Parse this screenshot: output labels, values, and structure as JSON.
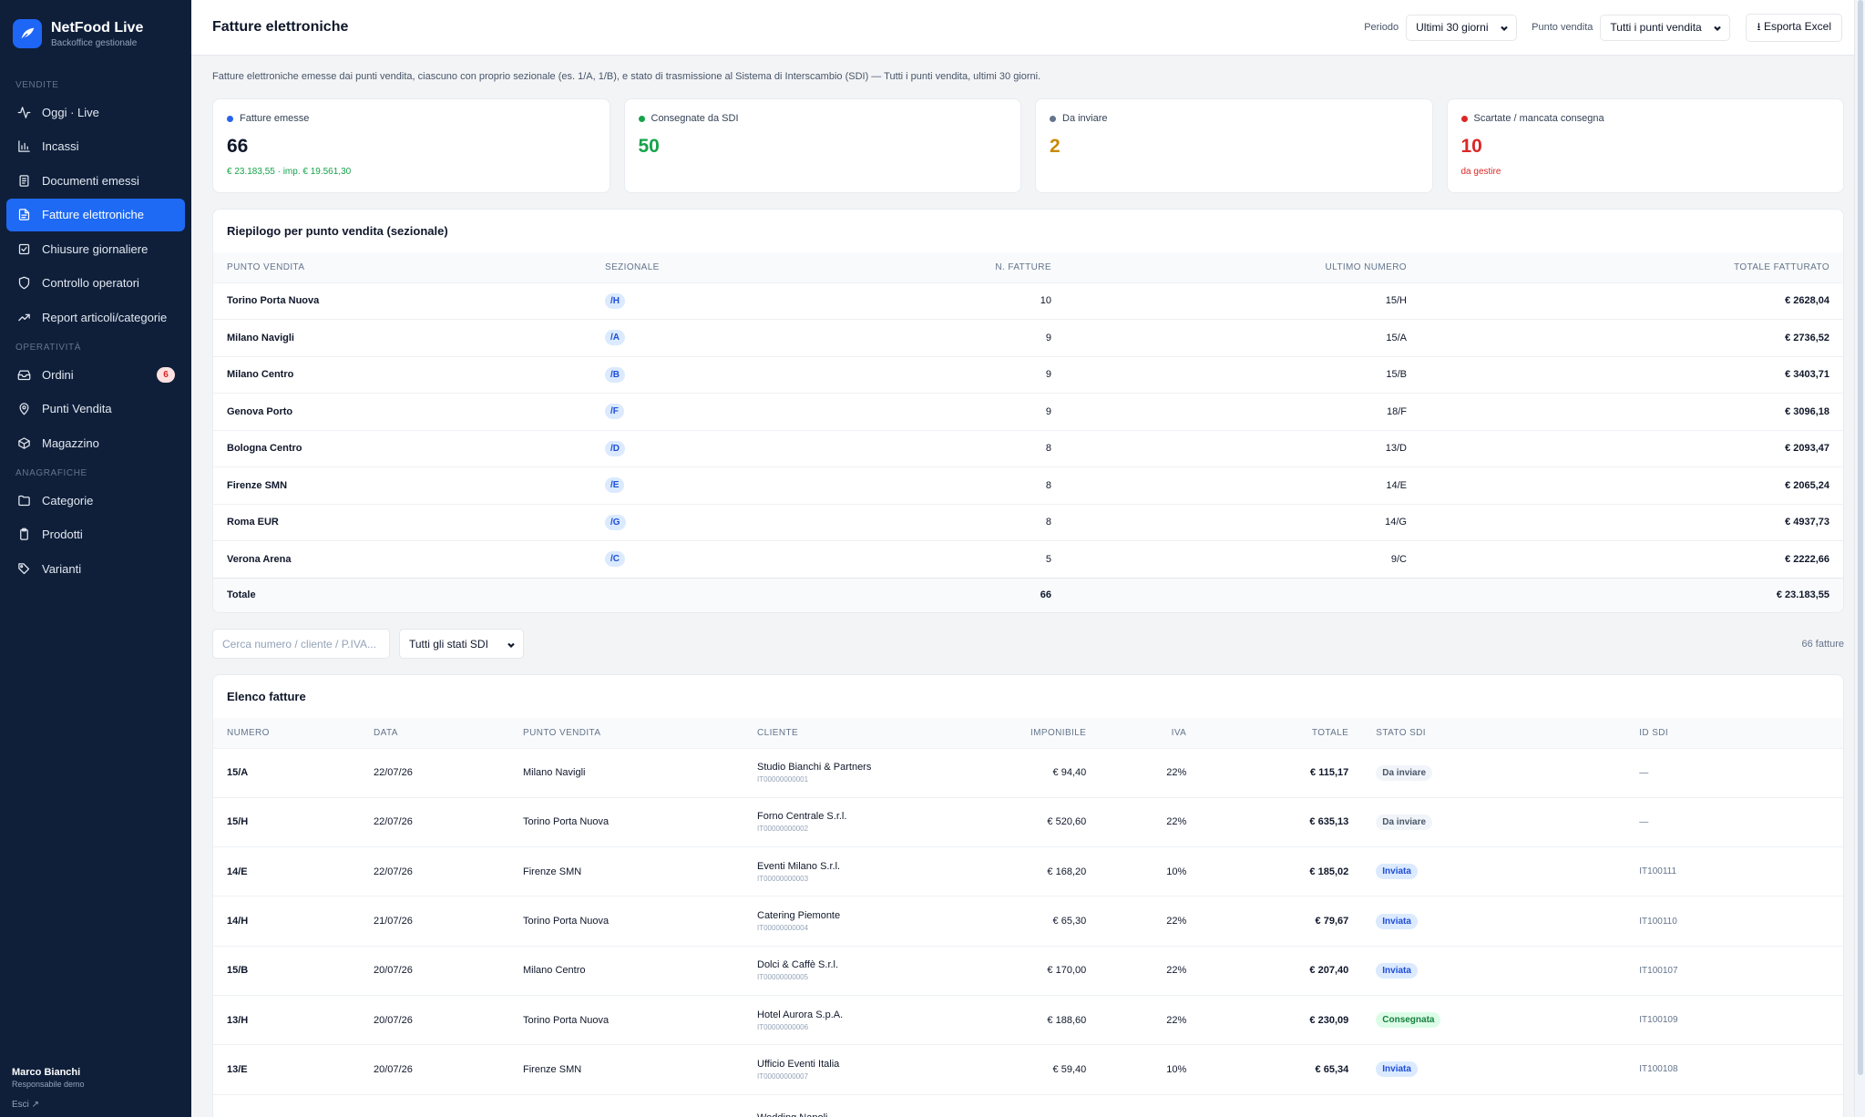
{
  "brand": {
    "name": "NetFood Live",
    "subtitle": "Backoffice gestionale"
  },
  "sidebar": {
    "sections": [
      {
        "title": "Vendite",
        "items": [
          {
            "label": "Oggi · Live",
            "icon": "activity-icon"
          },
          {
            "label": "Incassi",
            "icon": "bar-chart-icon"
          },
          {
            "label": "Documenti emessi",
            "icon": "receipt-icon"
          },
          {
            "label": "Fatture elettroniche",
            "icon": "file-icon",
            "active": true
          },
          {
            "label": "Chiusure giornaliere",
            "icon": "check-square-icon"
          },
          {
            "label": "Controllo operatori",
            "icon": "shield-icon"
          },
          {
            "label": "Report articoli/categorie",
            "icon": "trending-up-icon"
          }
        ]
      },
      {
        "title": "Operatività",
        "items": [
          {
            "label": "Ordini",
            "icon": "inbox-icon",
            "badge": "6"
          },
          {
            "label": "Punti Vendita",
            "icon": "map-pin-icon"
          },
          {
            "label": "Magazzino",
            "icon": "box-icon"
          }
        ]
      },
      {
        "title": "Anagrafiche",
        "items": [
          {
            "label": "Categorie",
            "icon": "folder-icon"
          },
          {
            "label": "Prodotti",
            "icon": "clipboard-icon"
          },
          {
            "label": "Varianti",
            "icon": "tag-icon"
          }
        ]
      }
    ]
  },
  "user": {
    "name": "Marco Bianchi",
    "role": "Responsabile demo",
    "logout": "Esci ↗"
  },
  "header": {
    "title": "Fatture elettroniche",
    "period_label": "Periodo",
    "period_value": "Ultimi 30 giorni",
    "store_label": "Punto vendita",
    "store_value": "Tutti i punti vendita",
    "export_label": "⭳ Esporta Excel"
  },
  "intro": "Fatture elettroniche emesse dai punti vendita, ciascuno con proprio sezionale (es. 1/A, 1/B), e stato di trasmissione al Sistema di Interscambio (SDI) — Tutti i punti vendita, ultimi 30 giorni.",
  "kpis": [
    {
      "label": "Fatture emesse",
      "value": "66",
      "sub": "€ 23.183,55 · imp. € 19.561,30",
      "dot": "#2563eb",
      "value_color": "#0f172a",
      "sub_color": "#16a34a"
    },
    {
      "label": "Consegnate da SDI",
      "value": "50",
      "sub": "",
      "dot": "#16a34a",
      "value_color": "#16a34a",
      "sub_color": "#16a34a"
    },
    {
      "label": "Da inviare",
      "value": "2",
      "sub": "",
      "dot": "#64748b",
      "value_color": "#ca8a04",
      "sub_color": "#64748b"
    },
    {
      "label": "Scartate / mancata consegna",
      "value": "10",
      "sub": "da gestire",
      "dot": "#dc2626",
      "value_color": "#dc2626",
      "sub_color": "#dc2626"
    }
  ],
  "summary": {
    "title": "Riepilogo per punto vendita (sezionale)",
    "columns": [
      "Punto vendita",
      "Sezionale",
      "N. fatture",
      "Ultimo numero",
      "Totale fatturato"
    ],
    "rows": [
      {
        "store": "Torino Porta Nuova",
        "sezionale": "/H",
        "count": "10",
        "last": "15/H",
        "total": "€ 2628,04"
      },
      {
        "store": "Milano Navigli",
        "sezionale": "/A",
        "count": "9",
        "last": "15/A",
        "total": "€ 2736,52"
      },
      {
        "store": "Milano Centro",
        "sezionale": "/B",
        "count": "9",
        "last": "15/B",
        "total": "€ 3403,71"
      },
      {
        "store": "Genova Porto",
        "sezionale": "/F",
        "count": "9",
        "last": "18/F",
        "total": "€ 3096,18"
      },
      {
        "store": "Bologna Centro",
        "sezionale": "/D",
        "count": "8",
        "last": "13/D",
        "total": "€ 2093,47"
      },
      {
        "store": "Firenze SMN",
        "sezionale": "/E",
        "count": "8",
        "last": "14/E",
        "total": "€ 2065,24"
      },
      {
        "store": "Roma EUR",
        "sezionale": "/G",
        "count": "8",
        "last": "14/G",
        "total": "€ 4937,73"
      },
      {
        "store": "Verona Arena",
        "sezionale": "/C",
        "count": "5",
        "last": "9/C",
        "total": "€ 2222,66"
      }
    ],
    "total_label": "Totale",
    "total_count": "66",
    "total_amount": "€ 23.183,55"
  },
  "filters": {
    "search_placeholder": "Cerca numero / cliente / P.IVA...",
    "status_value": "Tutti gli stati SDI",
    "count": "66 fatture"
  },
  "invoices": {
    "title": "Elenco fatture",
    "columns": [
      "Numero",
      "Data",
      "Punto vendita",
      "Cliente",
      "Imponibile",
      "IVA",
      "Totale",
      "Stato SDI",
      "ID SDI"
    ],
    "rows": [
      {
        "num": "15/A",
        "date": "22/07/26",
        "store": "Milano Navigli",
        "client": "Studio Bianchi & Partners",
        "vat": "IT00000000001",
        "imp": "€ 94,40",
        "iva": "22%",
        "tot": "€ 115,17",
        "status": "Da inviare",
        "st": "da",
        "id": "—"
      },
      {
        "num": "15/H",
        "date": "22/07/26",
        "store": "Torino Porta Nuova",
        "client": "Forno Centrale S.r.l.",
        "vat": "IT00000000002",
        "imp": "€ 520,60",
        "iva": "22%",
        "tot": "€ 635,13",
        "status": "Da inviare",
        "st": "da",
        "id": "—"
      },
      {
        "num": "14/E",
        "date": "22/07/26",
        "store": "Firenze SMN",
        "client": "Eventi Milano S.r.l.",
        "vat": "IT00000000003",
        "imp": "€ 168,20",
        "iva": "10%",
        "tot": "€ 185,02",
        "status": "Inviata",
        "st": "inv",
        "id": "IT100111"
      },
      {
        "num": "14/H",
        "date": "21/07/26",
        "store": "Torino Porta Nuova",
        "client": "Catering Piemonte",
        "vat": "IT00000000004",
        "imp": "€ 65,30",
        "iva": "22%",
        "tot": "€ 79,67",
        "status": "Inviata",
        "st": "inv",
        "id": "IT100110"
      },
      {
        "num": "15/B",
        "date": "20/07/26",
        "store": "Milano Centro",
        "client": "Dolci & Caffè S.r.l.",
        "vat": "IT00000000005",
        "imp": "€ 170,00",
        "iva": "22%",
        "tot": "€ 207,40",
        "status": "Inviata",
        "st": "inv",
        "id": "IT100107"
      },
      {
        "num": "13/H",
        "date": "20/07/26",
        "store": "Torino Porta Nuova",
        "client": "Hotel Aurora S.p.A.",
        "vat": "IT00000000006",
        "imp": "€ 188,60",
        "iva": "22%",
        "tot": "€ 230,09",
        "status": "Consegnata",
        "st": "con",
        "id": "IT100109"
      },
      {
        "num": "13/E",
        "date": "20/07/26",
        "store": "Firenze SMN",
        "client": "Ufficio Eventi Italia",
        "vat": "IT00000000007",
        "imp": "€ 59,40",
        "iva": "10%",
        "tot": "€ 65,34",
        "status": "Inviata",
        "st": "inv",
        "id": "IT100108"
      },
      {
        "num": "",
        "date": "",
        "store": "",
        "client": "Wedding Napoli",
        "vat": "",
        "imp": "",
        "iva": "",
        "tot": "",
        "status": "",
        "st": "",
        "id": ""
      }
    ]
  }
}
